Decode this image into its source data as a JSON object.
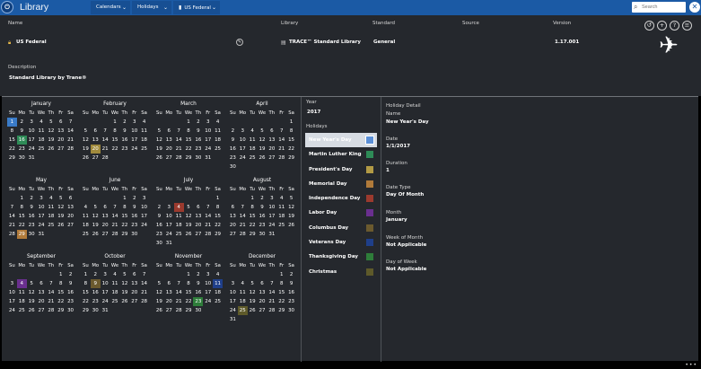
{
  "app": {
    "title": "Library",
    "logo": "app-logo-icon"
  },
  "nav": {
    "calendars": "Calendars",
    "holidays": "Holidays",
    "us_federal": "US Federal",
    "search_placeholder": "Search"
  },
  "header": {
    "labels": {
      "name": "Name",
      "library": "Library",
      "standard": "Standard",
      "source": "Source",
      "version": "Version"
    },
    "values": {
      "name": "US Federal",
      "library": "TRACE™ Standard Library",
      "standard": "General",
      "source": "",
      "version": "1.17.001"
    },
    "description_label": "Description",
    "description_value": "Standard Library by Trane®",
    "icons": [
      "undo-icon",
      "add-icon",
      "help-icon",
      "menu-icon",
      "airplane-icon"
    ]
  },
  "calendar": {
    "year": 2017,
    "dow": [
      "Su",
      "Mo",
      "Tu",
      "We",
      "Th",
      "Fr",
      "Sa"
    ],
    "months": [
      "January",
      "February",
      "March",
      "April",
      "May",
      "June",
      "July",
      "August",
      "September",
      "October",
      "November",
      "December"
    ],
    "highlights": [
      {
        "month": 1,
        "day": 1,
        "color": "#3a7bc8"
      },
      {
        "month": 1,
        "day": 16,
        "color": "#2e8b57"
      },
      {
        "month": 2,
        "day": 20,
        "color": "#a08a3c"
      },
      {
        "month": 5,
        "day": 29,
        "color": "#b07a3a"
      },
      {
        "month": 7,
        "day": 4,
        "color": "#9b3a2e"
      },
      {
        "month": 9,
        "day": 4,
        "color": "#6a2f8f"
      },
      {
        "month": 10,
        "day": 9,
        "color": "#6b5a2e"
      },
      {
        "month": 11,
        "day": 11,
        "color": "#1f3f8a"
      },
      {
        "month": 11,
        "day": 23,
        "color": "#2e7d3a"
      },
      {
        "month": 12,
        "day": 25,
        "color": "#5e5a2a"
      }
    ]
  },
  "panel": {
    "year_label": "Year",
    "year_value": "2017",
    "holidays_label": "Holidays",
    "holidays": [
      {
        "name": "New Year's Day",
        "color": "#5b8fd6",
        "selected": true
      },
      {
        "name": "Martin Luther King",
        "color": "#2e8b57"
      },
      {
        "name": "President's Day",
        "color": "#b29a45"
      },
      {
        "name": "Memorial Day",
        "color": "#b07a3a"
      },
      {
        "name": "Independence Day",
        "color": "#9b3a2e"
      },
      {
        "name": "Labor Day",
        "color": "#6a2f8f"
      },
      {
        "name": "Columbus Day",
        "color": "#6b5a2e"
      },
      {
        "name": "Veterans Day",
        "color": "#1f3f8a"
      },
      {
        "name": "Thanksgiving Day",
        "color": "#2e7d3a"
      },
      {
        "name": "Christmas",
        "color": "#5e5a2a"
      }
    ]
  },
  "detail": {
    "title": "Holiday Detail",
    "name_label": "Name",
    "name_value": "New Year's Day",
    "date_label": "Date",
    "date_value": "1/1/2017",
    "duration_label": "Duration",
    "duration_value": "1",
    "date_type_label": "Date Type",
    "date_type_value": "Day Of Month",
    "month_label": "Month",
    "month_value": "January",
    "week_of_month_label": "Week of Month",
    "week_of_month_value": "Not Applicable",
    "day_of_week_label": "Day of Week",
    "day_of_week_value": "Not Applicable"
  },
  "status": {
    "dots": "•••"
  }
}
